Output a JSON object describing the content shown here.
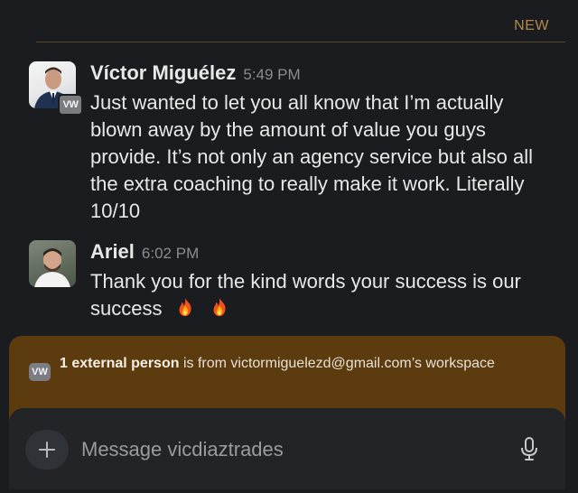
{
  "divider": {
    "label": "NEW"
  },
  "messages": [
    {
      "sender": "Víctor Miguélez",
      "time": "5:49 PM",
      "avatar_badge": "VW",
      "text": "Just wanted to let you all know that I’m actually blown away by the amount of value you guys provide. It’s not only an agency service but also all the extra coaching to really make it work. Literally 10/10"
    },
    {
      "sender": "Ariel",
      "time": "6:02 PM",
      "text": "Thank you for the kind words your success is our success",
      "emoji": [
        "fire-icon",
        "fire-icon"
      ]
    }
  ],
  "external_banner": {
    "badge": "VW",
    "bold": "1 external person",
    "rest": " is from victormiguelezd@gmail.com’s workspace"
  },
  "composer": {
    "placeholder": "Message vicdiaztrades",
    "plus_icon": "plus-icon",
    "mic_icon": "microphone-icon"
  },
  "colors": {
    "background": "#1b1c20",
    "banner": "#5c3b0f",
    "new_label": "#b0894a"
  }
}
